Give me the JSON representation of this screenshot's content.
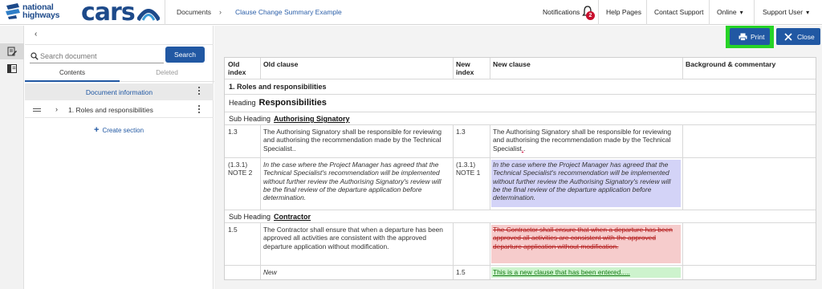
{
  "header": {
    "brand": "national highways",
    "app_name": "cars",
    "breadcrumb": {
      "documents": "Documents",
      "current": "Clause Change Summary Example"
    },
    "notifications_label": "Notifications",
    "notifications_count": "2",
    "help_pages": "Help Pages",
    "contact_support": "Contact Support",
    "online": "Online",
    "user": "Support User"
  },
  "sidebar": {
    "search_placeholder": "Search document",
    "search_button": "Search",
    "tabs": {
      "contents": "Contents",
      "deleted": "Deleted"
    },
    "doc_info": "Document information",
    "section": "1. Roles and responsibilities",
    "create_section": "Create section"
  },
  "toolbar": {
    "print": "Print",
    "close": "Close"
  },
  "table": {
    "headers": {
      "old_index": "Old\nindex",
      "old_clause": "Old clause",
      "new_index": "New\nindex",
      "new_clause": "New clause",
      "background": "Background & commentary"
    },
    "section_title": "1. Roles and responsibilities",
    "heading_label": "Heading",
    "heading_value": "Responsibilities",
    "subheading_label": "Sub Heading",
    "subheading1": "Authorising Signatory",
    "subheading2": "Contractor",
    "rows": [
      {
        "old_index": "1.3",
        "old_clause": "The Authorising Signatory shall be responsible for reviewing and authorising the recommendation made by the Technical Specialist..",
        "new_index": "1.3",
        "new_clause_main": "The Authorising Signatory shall be responsible for reviewing and authorising the recommendation made by the Technical Specialist",
        "new_clause_mark": ".",
        "new_clause_end": "."
      },
      {
        "old_index": "(1.3.1)\nNOTE 2",
        "old_clause": "In the case where the Project Manager has agreed that the Technical Specialist's recommendation will be implemented without further review the Authorising Signatory's review will be the final review of the departure application before determination.",
        "new_index": "(1.3.1)\nNOTE 1",
        "new_clause": "In the case where the Project Manager has agreed that the Technical Specialist's recommendation will be implemented without further review the Authorising Signatory's review will be the final review of the departure application before determination."
      },
      {
        "old_index": "1.5",
        "old_clause": "The Contractor shall ensure that when a departure has been approved all activities are consistent with the approved departure application without modification.",
        "new_index": "",
        "new_clause": "The Contractor shall ensure that when a departure has been approved all activities are consistent with the approved departure application without modification."
      },
      {
        "old_index": "",
        "old_clause": "New",
        "new_index": "1.5",
        "new_clause": "This is a new clause that has been entered....."
      }
    ]
  },
  "colors": {
    "brand_blue": "#2158a3",
    "highlight_green": "#27d327",
    "moved_blue": "#d3d3f7",
    "deleted_red": "#f6cccc",
    "added_green": "#cdf3cd"
  }
}
